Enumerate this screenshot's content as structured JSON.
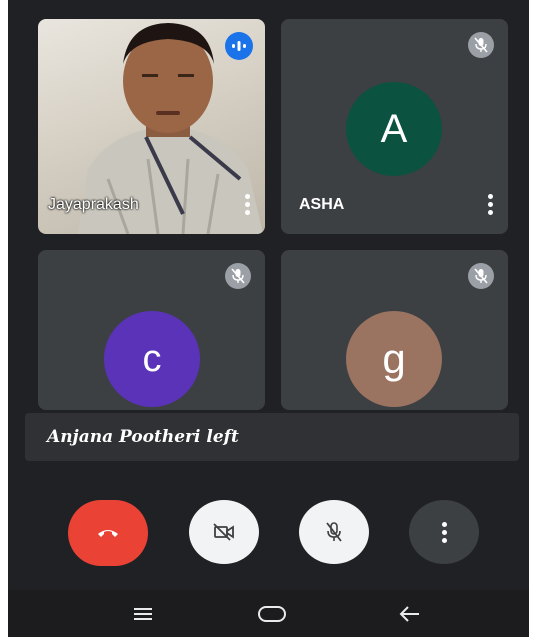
{
  "participants": [
    {
      "name": "Jayaprakash",
      "state": "speaking",
      "video": true
    },
    {
      "name": "ASHA",
      "avatar_letter": "A",
      "avatar_color": "#0b5240",
      "state": "muted"
    },
    {
      "name": "",
      "avatar_letter": "c",
      "avatar_color": "#5a33b9",
      "state": "muted"
    },
    {
      "name": "",
      "avatar_letter": "g",
      "avatar_color": "#9a7361",
      "state": "muted"
    }
  ],
  "toast": {
    "text": "Anjana Pootheri left"
  },
  "controls": {
    "end_call": {
      "icon": "phone-hangup-icon",
      "color": "#ea4335"
    },
    "camera": {
      "icon": "video-off-icon",
      "state": "off"
    },
    "microphone": {
      "icon": "mic-off-icon",
      "state": "off"
    },
    "more": {
      "icon": "more-vert-icon"
    }
  },
  "navbar": {
    "recent": "recent-apps-icon",
    "home": "home-icon",
    "back": "back-arrow-icon"
  }
}
